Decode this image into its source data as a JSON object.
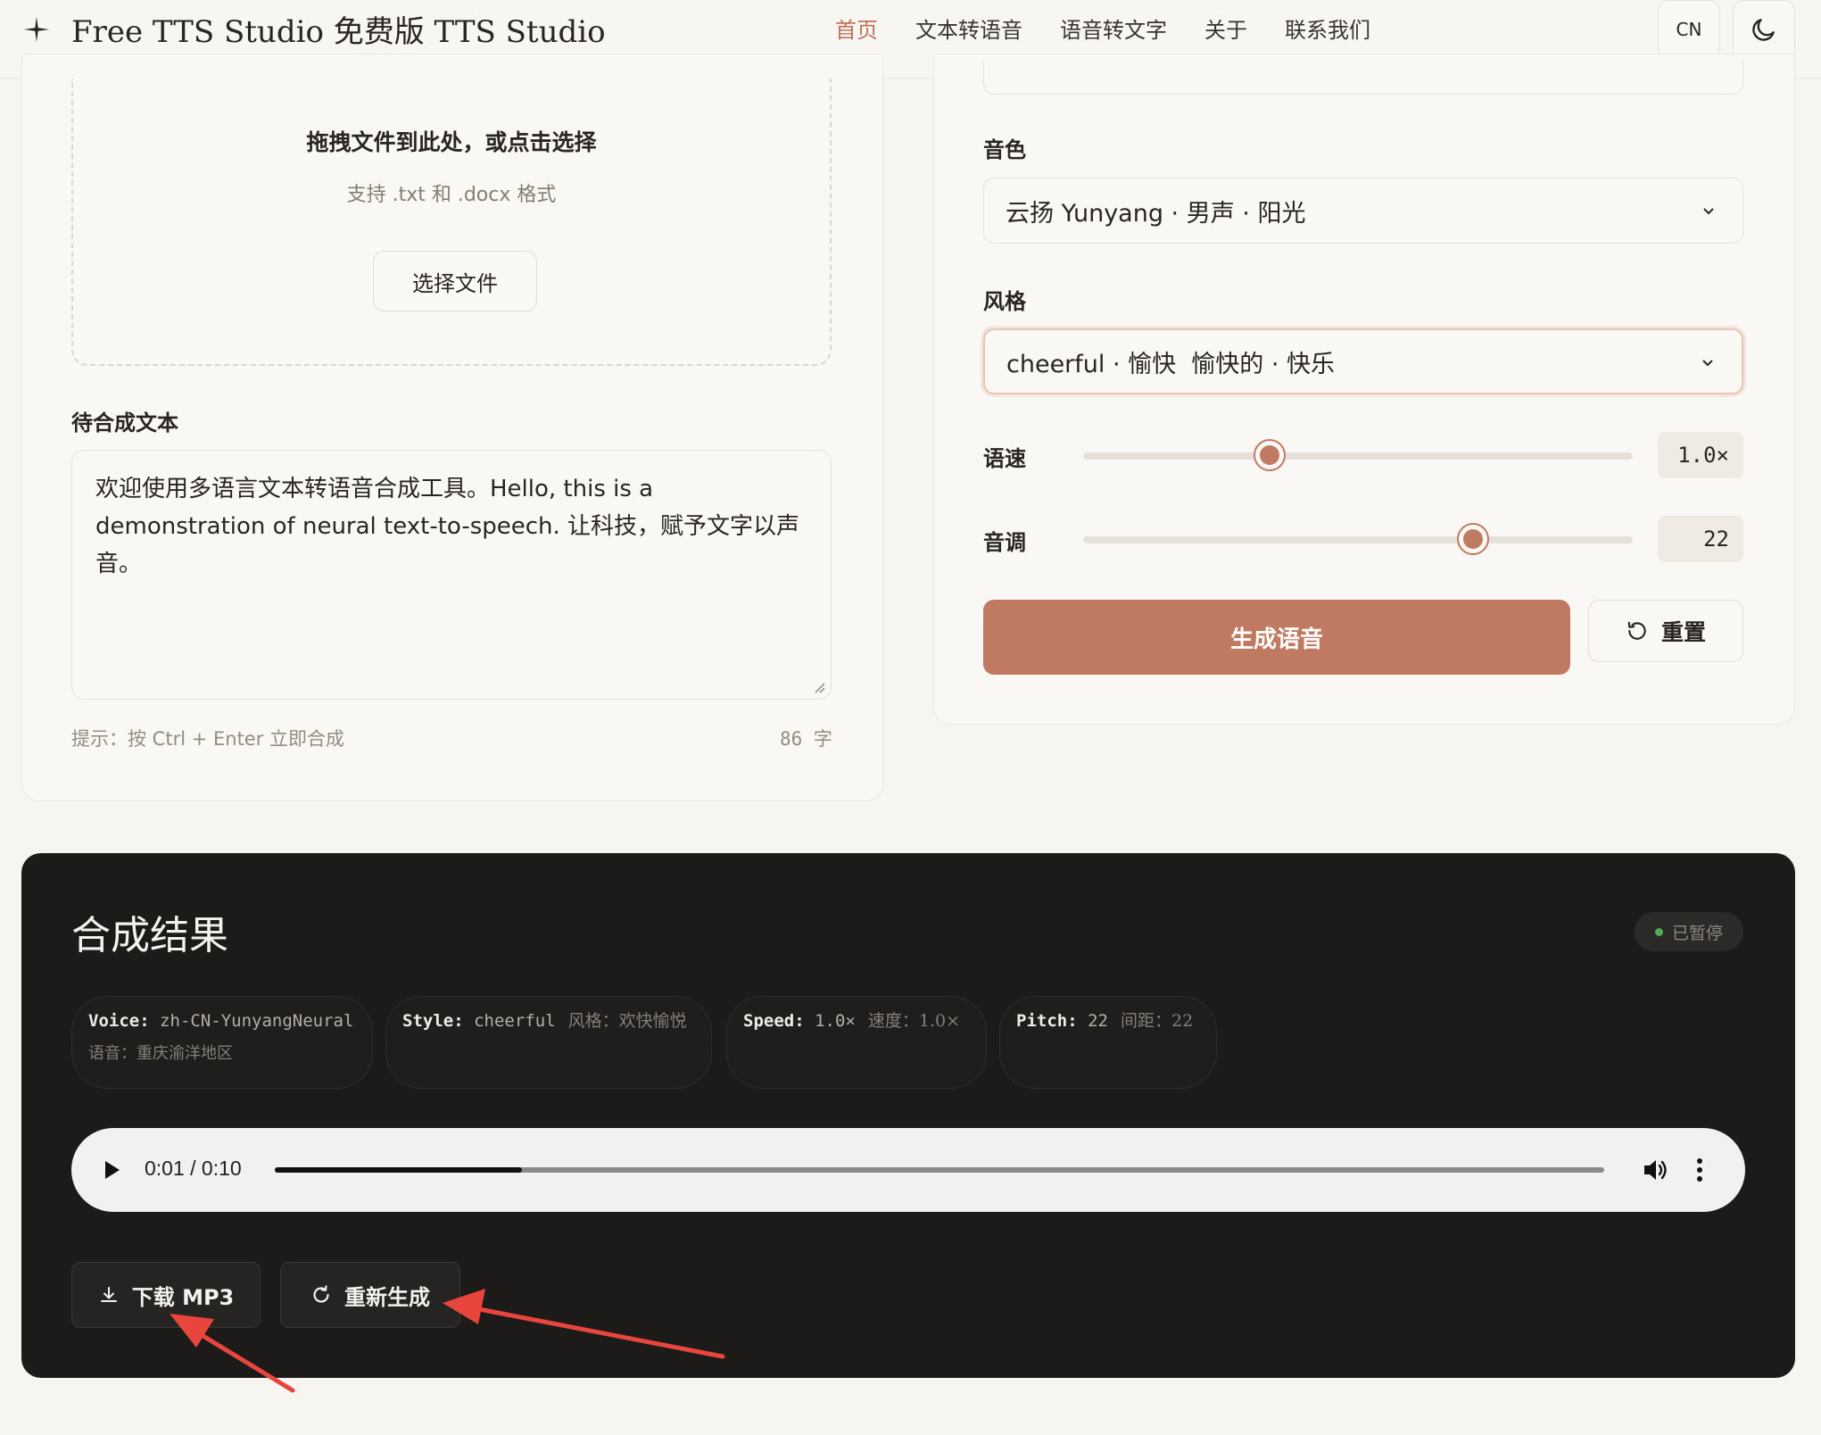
{
  "header": {
    "brand": "Free TTS Studio 免费版 TTS Studio",
    "nav": [
      "首页",
      "文本转语音",
      "语音转文字",
      "关于",
      "联系我们"
    ],
    "lang": "CN"
  },
  "upload": {
    "title": "拖拽文件到此处，或点击选择",
    "subtitle": "支持 .txt 和 .docx 格式",
    "button": "选择文件"
  },
  "text_section": {
    "label": "待合成文本",
    "content": "欢迎使用多语言文本转语音合成工具。Hello, this is a demonstration of neural text-to-speech. 让科技，赋予文字以声音。",
    "hint": "提示：按 Ctrl + Enter 立即合成",
    "count": "86 字"
  },
  "settings": {
    "voice_label": "音色",
    "voice_value": "云扬 Yunyang · 男声 · 阳光",
    "style_label": "风格",
    "style_value": "cheerful · 愉快  愉快的 · 快乐",
    "speed_label": "语速",
    "speed_value": "1.0×",
    "speed_fraction": 0.34,
    "pitch_label": "音调",
    "pitch_value": "22",
    "pitch_fraction": 0.71,
    "generate_button": "生成语音",
    "reset_button": "重置"
  },
  "result": {
    "title": "合成结果",
    "status": "已暂停",
    "chips": [
      {
        "key": "Voice:",
        "value": "zh-CN-YunyangNeural",
        "sub": "",
        "line2": "语音：重庆渝洋地区"
      },
      {
        "key": "Style:",
        "value": "cheerful",
        "sub": "风格：欢快愉悦",
        "line2": ""
      },
      {
        "key": "Speed:",
        "value": "1.0×",
        "sub": "速度：1.0×",
        "line2": ""
      },
      {
        "key": "Pitch:",
        "value": "22",
        "sub": "间距：22",
        "line2": ""
      }
    ],
    "player": {
      "time": "0:01 / 0:10",
      "progress": 0.186
    },
    "download_button": "下载 MP3",
    "regenerate_button": "重新生成"
  },
  "colors": {
    "accent": "#c07a62",
    "nav_active": "#c07358",
    "panel_dark": "#1c1b1a",
    "annotation_arrow": "#e8453c"
  }
}
